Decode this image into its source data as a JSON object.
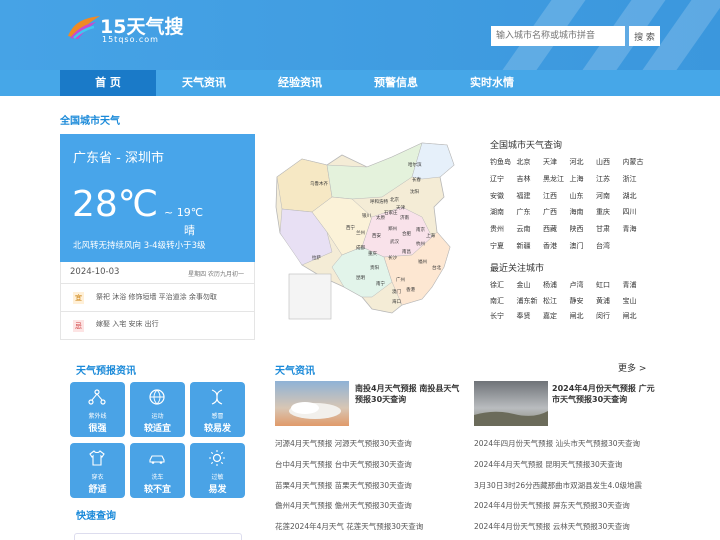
{
  "header": {
    "logo_text": "15天气搜",
    "logo_sub": "15tqso.com",
    "search_placeholder": "输入城市名称或城市拼音",
    "search_button": "搜 索"
  },
  "nav": [
    "首 页",
    "天气资讯",
    "经验资讯",
    "预警信息",
    "实时水情"
  ],
  "weather": {
    "section_title": "全国城市天气",
    "location": "广东省 - 深圳市",
    "temp": "28℃",
    "low": "~ 19℃",
    "condition": "晴",
    "wind": "北风转无持续风向  3-4级转小于3级",
    "date": "2024-10-03",
    "weekday_lunar": "星期四  农历九月初一",
    "yi_badge": "宜",
    "yi_text": "祭祀 沐浴 修饰垣墙 平治道涂 余事勿取",
    "ji_badge": "忌",
    "ji_text": "嫁娶 入宅 安床 出行"
  },
  "map": {
    "labels": [
      "哈尔滨",
      "长春",
      "沈阳",
      "北京",
      "天津",
      "呼和浩特",
      "乌鲁木齐",
      "石家庄",
      "银川",
      "太原",
      "济南",
      "西宁",
      "兰州",
      "郑州",
      "合肥",
      "南京",
      "上海",
      "西安",
      "武汉",
      "杭州",
      "拉萨",
      "成都",
      "重庆",
      "长沙",
      "南昌",
      "福州",
      "贵阳",
      "台北",
      "昆明",
      "南宁",
      "广州",
      "澳门",
      "香港",
      "海口"
    ]
  },
  "city_query": {
    "title": "全国城市天气查询",
    "cities": [
      "钓鱼岛",
      "北京",
      "天津",
      "河北",
      "山西",
      "内蒙古",
      "辽宁",
      "吉林",
      "黑龙江",
      "上海",
      "江苏",
      "浙江",
      "安徽",
      "福建",
      "江西",
      "山东",
      "河南",
      "湖北",
      "湖南",
      "广东",
      "广西",
      "海南",
      "重庆",
      "四川",
      "贵州",
      "云南",
      "西藏",
      "陕西",
      "甘肃",
      "青海",
      "宁夏",
      "新疆",
      "香港",
      "澳门",
      "台湾"
    ]
  },
  "recent": {
    "title": "最近关注城市",
    "cities": [
      "徐汇",
      "金山",
      "杨浦",
      "卢湾",
      "虹口",
      "青浦",
      "南汇",
      "浦东新",
      "松江",
      "静安",
      "黄浦",
      "宝山",
      "长宁",
      "奉贤",
      "嘉定",
      "闸北",
      "闵行",
      "闸北"
    ]
  },
  "forecast": {
    "title": "天气预报资讯",
    "tiles": [
      {
        "icon": "molecule-icon",
        "sub": "紫外线",
        "level": "很强"
      },
      {
        "icon": "ball-icon",
        "sub": "运动",
        "level": "较适宜"
      },
      {
        "icon": "dna-icon",
        "sub": "感冒",
        "level": "较易发"
      },
      {
        "icon": "shirt-icon",
        "sub": "穿衣",
        "level": "舒适"
      },
      {
        "icon": "car-icon",
        "sub": "洗车",
        "level": "较不宜"
      },
      {
        "icon": "sun-icon",
        "sub": "过敏",
        "level": "易发"
      }
    ],
    "quick_title": "快速查询"
  },
  "news": {
    "title": "天气资讯",
    "more": "更多 >",
    "featured": [
      {
        "title": "南投4月天气预报 南投县天气预报30天查询"
      },
      {
        "title": "2024年4月份天气预报 广元市天气预报30天查询"
      }
    ],
    "left_links": [
      "河源4月天气预报 河源天气预报30天查询",
      "台中4月天气预报 台中天气预报30天查询",
      "苗栗4月天气预报 苗栗天气预报30天查询",
      "儋州4月天气预报 儋州天气预报30天查询",
      "花莲2024年4月天气 花莲天气预报30天查询"
    ],
    "right_links": [
      "2024年四月份天气预报 汕头市天气预报30天查询",
      "2024年4月天气预报 昆明天气预报30天查询",
      "3月30日3时26分西藏那曲市双湖县发生4.0级地震",
      "2024年4月份天气预报 屏东天气预报30天查询",
      "2024年4月份天气预报 云林天气预报30天查询"
    ]
  },
  "colors": {
    "primary": "#46a7e8",
    "nav_active": "#1a7ac8",
    "title_blue": "#1b8ad9"
  }
}
